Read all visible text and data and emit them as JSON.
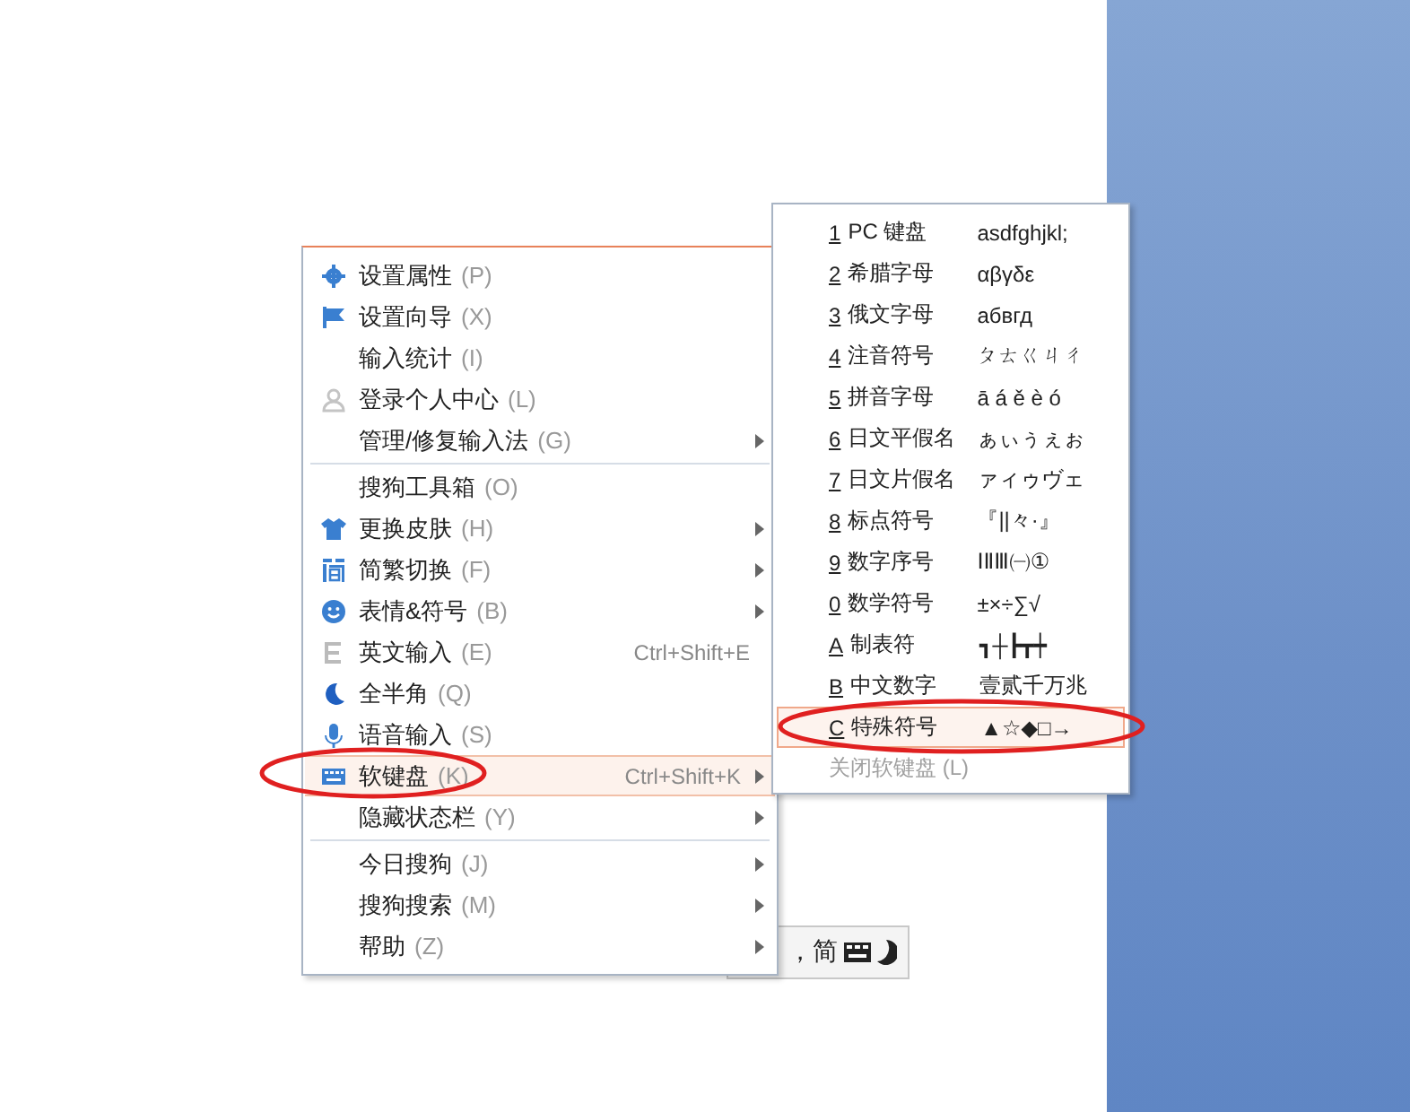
{
  "menu": {
    "items": [
      {
        "label": "设置属性",
        "key": "(P)",
        "separator_before": false,
        "submenu": false,
        "selected": false
      },
      {
        "label": "设置向导",
        "key": "(X)",
        "separator_before": false,
        "submenu": false,
        "selected": false
      },
      {
        "label": "输入统计",
        "key": "(I)",
        "separator_before": false,
        "submenu": false,
        "selected": false
      },
      {
        "label": "登录个人中心",
        "key": "(L)",
        "separator_before": false,
        "submenu": false,
        "selected": false
      },
      {
        "label": "管理/修复输入法",
        "key": "(G)",
        "separator_before": false,
        "submenu": true,
        "selected": false
      },
      {
        "label": "搜狗工具箱",
        "key": "(O)",
        "separator_before": true,
        "submenu": false,
        "selected": false
      },
      {
        "label": "更换皮肤",
        "key": "(H)",
        "separator_before": false,
        "submenu": true,
        "selected": false
      },
      {
        "label": "简繁切换",
        "key": "(F)",
        "separator_before": false,
        "submenu": true,
        "selected": false
      },
      {
        "label": "表情&符号",
        "key": "(B)",
        "separator_before": false,
        "submenu": true,
        "selected": false
      },
      {
        "label": "英文输入",
        "key": "(E)",
        "shortcut": "Ctrl+Shift+E",
        "separator_before": false,
        "submenu": false,
        "selected": false
      },
      {
        "label": "全半角",
        "key": "(Q)",
        "separator_before": false,
        "submenu": false,
        "selected": false
      },
      {
        "label": "语音输入",
        "key": "(S)",
        "separator_before": false,
        "submenu": false,
        "selected": false
      },
      {
        "label": "软键盘",
        "key": "(K)",
        "shortcut": "Ctrl+Shift+K",
        "separator_before": false,
        "submenu": true,
        "selected": true
      },
      {
        "label": "隐藏状态栏",
        "key": "(Y)",
        "separator_before": false,
        "submenu": true,
        "selected": false
      },
      {
        "label": "今日搜狗",
        "key": "(J)",
        "separator_before": true,
        "submenu": true,
        "selected": false
      },
      {
        "label": "搜狗搜索",
        "key": "(M)",
        "separator_before": false,
        "submenu": true,
        "selected": false
      },
      {
        "label": "帮助",
        "key": "(Z)",
        "separator_before": false,
        "submenu": true,
        "selected": false
      }
    ]
  },
  "soft_keyboard_menu": {
    "items": [
      {
        "key": "1",
        "label": "PC 键盘",
        "sample": "asdfghjkl;",
        "selected": false,
        "disabled": false
      },
      {
        "key": "2",
        "label": "希腊字母",
        "sample": "αβγδε",
        "selected": false,
        "disabled": false
      },
      {
        "key": "3",
        "label": "俄文字母",
        "sample": "абвгд",
        "selected": false,
        "disabled": false
      },
      {
        "key": "4",
        "label": "注音符号",
        "sample": "ㄆㄊㄍㄐㄔ",
        "selected": false,
        "disabled": false
      },
      {
        "key": "5",
        "label": "拼音字母",
        "sample": "ā á ě è ó",
        "selected": false,
        "disabled": false
      },
      {
        "key": "6",
        "label": "日文平假名",
        "sample": "ぁぃぅぇぉ",
        "selected": false,
        "disabled": false
      },
      {
        "key": "7",
        "label": "日文片假名",
        "sample": "ァィゥヴェ",
        "selected": false,
        "disabled": false
      },
      {
        "key": "8",
        "label": "标点符号",
        "sample": "『||々·』",
        "selected": false,
        "disabled": false
      },
      {
        "key": "9",
        "label": "数字序号",
        "sample": "ⅠⅡⅢ㈠①",
        "selected": false,
        "disabled": false
      },
      {
        "key": "0",
        "label": "数学符号",
        "sample": "±×÷∑√",
        "selected": false,
        "disabled": false
      },
      {
        "key": "A",
        "label": "制表符",
        "sample": "┓┼┣┳┿",
        "selected": false,
        "disabled": false
      },
      {
        "key": "B",
        "label": "中文数字",
        "sample": "壹贰千万兆",
        "selected": false,
        "disabled": false
      },
      {
        "key": "C",
        "label": "特殊符号",
        "sample": "▲☆◆□→",
        "selected": true,
        "disabled": false
      },
      {
        "label": "关闭软键盘 (L)",
        "selected": false,
        "disabled": true
      }
    ]
  },
  "status_bar": {
    "text": "，简"
  }
}
